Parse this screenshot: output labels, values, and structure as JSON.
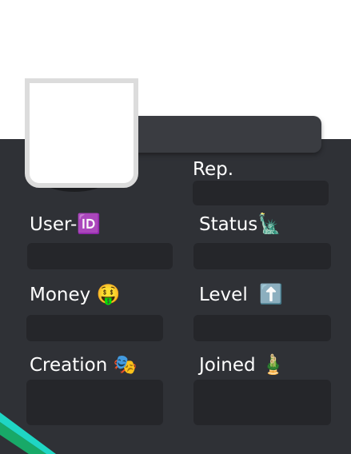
{
  "profile": {
    "rep_label": "Rep.",
    "user_id_label": "User-",
    "user_id_emoji": "🆔",
    "status_label": "Status",
    "status_emoji": "🗽",
    "money_label": "Money",
    "money_emoji": "🤑",
    "level_label": "Level",
    "level_emoji": "⬆️",
    "creation_label": "Creation",
    "creation_emoji": "🎭",
    "joined_label": "Joined",
    "joined_emoji": "🎍",
    "rep_value": "",
    "user_id_value": "",
    "status_value": "",
    "money_value": "",
    "level_value": "",
    "creation_value": "",
    "joined_value": ""
  },
  "colors": {
    "card_background": "#2f3136",
    "field_background": "#25262a",
    "banner": "#3a3c41",
    "accent_teal": "#1fd6c4",
    "accent_green": "#18a968"
  }
}
